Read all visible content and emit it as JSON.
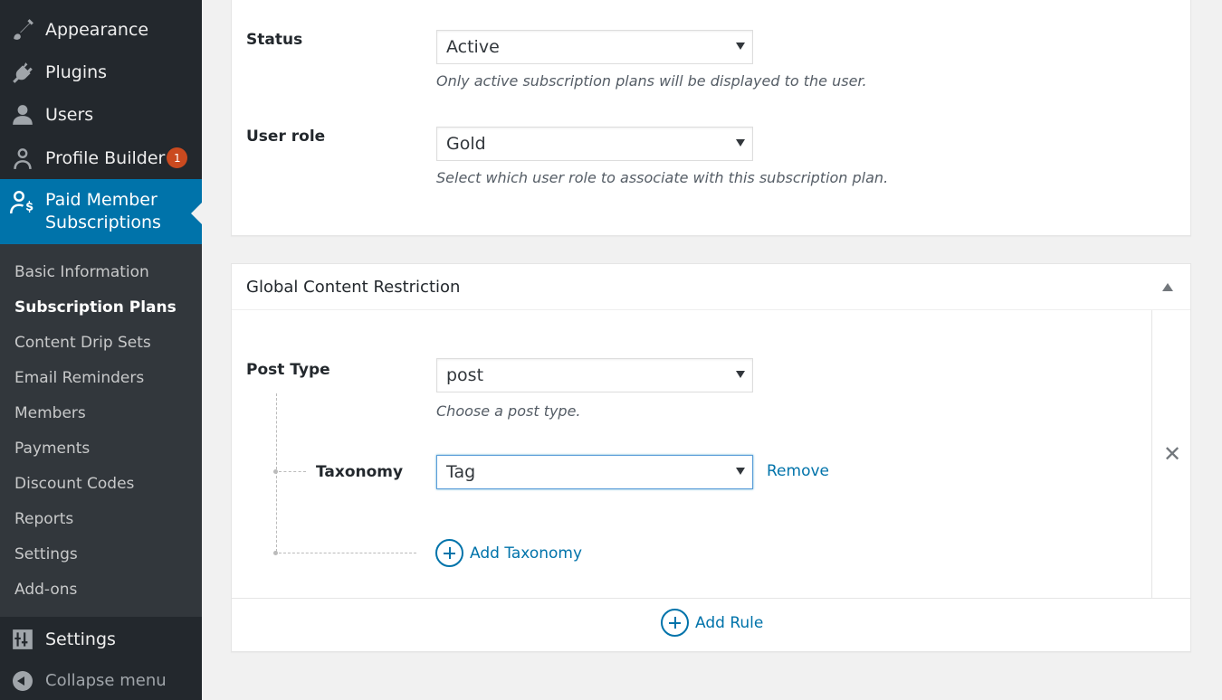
{
  "sidebar": {
    "items": [
      {
        "label": "Appearance",
        "icon": "paintbrush-icon"
      },
      {
        "label": "Plugins",
        "icon": "plug-icon"
      },
      {
        "label": "Users",
        "icon": "users-icon"
      },
      {
        "label": "Profile Builder",
        "icon": "user-outline-icon",
        "badge": "1"
      }
    ],
    "active": {
      "label_line1": "Paid Member",
      "label_line2": "Subscriptions",
      "icon": "member-dollar-icon"
    },
    "submenu": [
      "Basic Information",
      "Subscription Plans",
      "Content Drip Sets",
      "Email Reminders",
      "Members",
      "Payments",
      "Discount Codes",
      "Reports",
      "Settings",
      "Add-ons"
    ],
    "submenu_current": "Subscription Plans",
    "settings": {
      "label": "Settings",
      "icon": "settings-sliders-icon"
    },
    "collapse": {
      "label": "Collapse menu",
      "icon": "collapse-arrow-icon"
    }
  },
  "plan_settings": {
    "status": {
      "label": "Status",
      "value": "Active",
      "description": "Only active subscription plans will be displayed to the user."
    },
    "user_role": {
      "label": "User role",
      "value": "Gold",
      "description": "Select which user role to associate with this subscription plan."
    }
  },
  "restriction": {
    "title": "Global Content Restriction",
    "post_type": {
      "label": "Post Type",
      "value": "post",
      "description": "Choose a post type."
    },
    "taxonomy": {
      "label": "Taxonomy",
      "value": "Tag",
      "remove_label": "Remove"
    },
    "add_taxonomy_label": "Add Taxonomy",
    "add_rule_label": "Add Rule"
  },
  "colors": {
    "sidebar_bg": "#23282d",
    "submenu_bg": "#32373c",
    "active_bg": "#0073aa",
    "link": "#0073aa",
    "badge": "#ca4a1f"
  }
}
